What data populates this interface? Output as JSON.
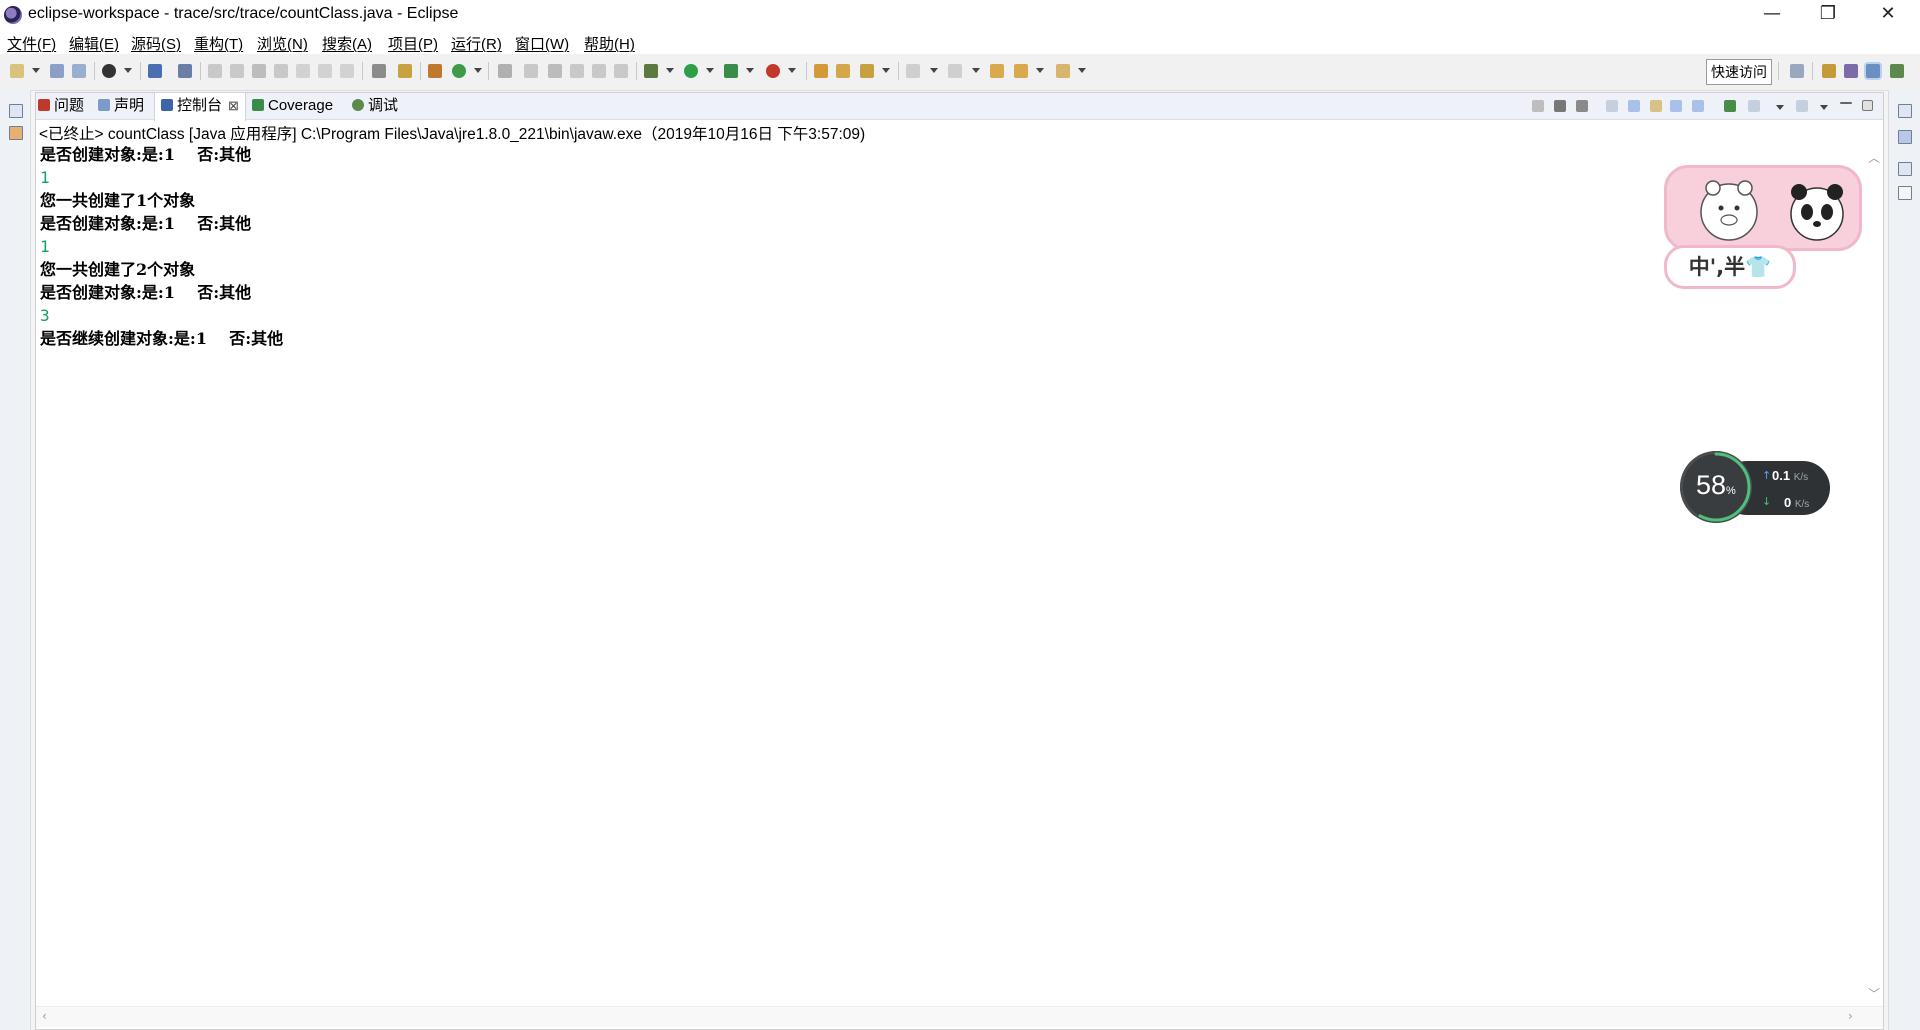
{
  "window": {
    "title": "eclipse-workspace - trace/src/trace/countClass.java - Eclipse",
    "minimize": "—",
    "maximize": "❐",
    "close": "✕"
  },
  "menu": [
    {
      "label": "文件(F)"
    },
    {
      "label": "编辑(E)"
    },
    {
      "label": "源码(S)"
    },
    {
      "label": "重构(T)"
    },
    {
      "label": "浏览(N)"
    },
    {
      "label": "搜索(A)"
    },
    {
      "label": "项目(P)"
    },
    {
      "label": "运行(R)"
    },
    {
      "label": "窗口(W)"
    },
    {
      "label": "帮助(H)"
    }
  ],
  "toolbar": {
    "quick_access": "快速访问"
  },
  "tabs": [
    {
      "label": "问题",
      "icon": "problems-icon"
    },
    {
      "label": "声明",
      "icon": "declaration-icon"
    },
    {
      "label": "控制台",
      "icon": "console-icon",
      "active": true
    },
    {
      "label": "Coverage",
      "icon": "coverage-icon"
    },
    {
      "label": "调试",
      "icon": "debug-icon"
    }
  ],
  "console": {
    "status": "<已终止> countClass [Java 应用程序] C:\\Program Files\\Java\\jre1.8.0_221\\bin\\javaw.exe（2019年10月16日 下午3:57:09)",
    "lines": [
      {
        "text": "是否创建对象:是:1    否:其他",
        "kind": "output"
      },
      {
        "text": "1",
        "kind": "input"
      },
      {
        "text": "您一共创建了1个对象",
        "kind": "output"
      },
      {
        "text": "是否创建对象:是:1    否:其他",
        "kind": "output"
      },
      {
        "text": "1",
        "kind": "input"
      },
      {
        "text": "您一共创建了2个对象",
        "kind": "output"
      },
      {
        "text": "是否创建对象:是:1    否:其他",
        "kind": "output"
      },
      {
        "text": "3",
        "kind": "input"
      },
      {
        "text": "是否继续创建对象:是:1    否:其他",
        "kind": "output"
      }
    ]
  },
  "sticker": {
    "label": "中',半👕"
  },
  "network": {
    "percent": "58",
    "percent_unit": "%",
    "up": "0.1",
    "down": "0",
    "unit": "K/s"
  },
  "colors": {
    "input_text": "#11a066",
    "accent": "#2b62c9"
  }
}
